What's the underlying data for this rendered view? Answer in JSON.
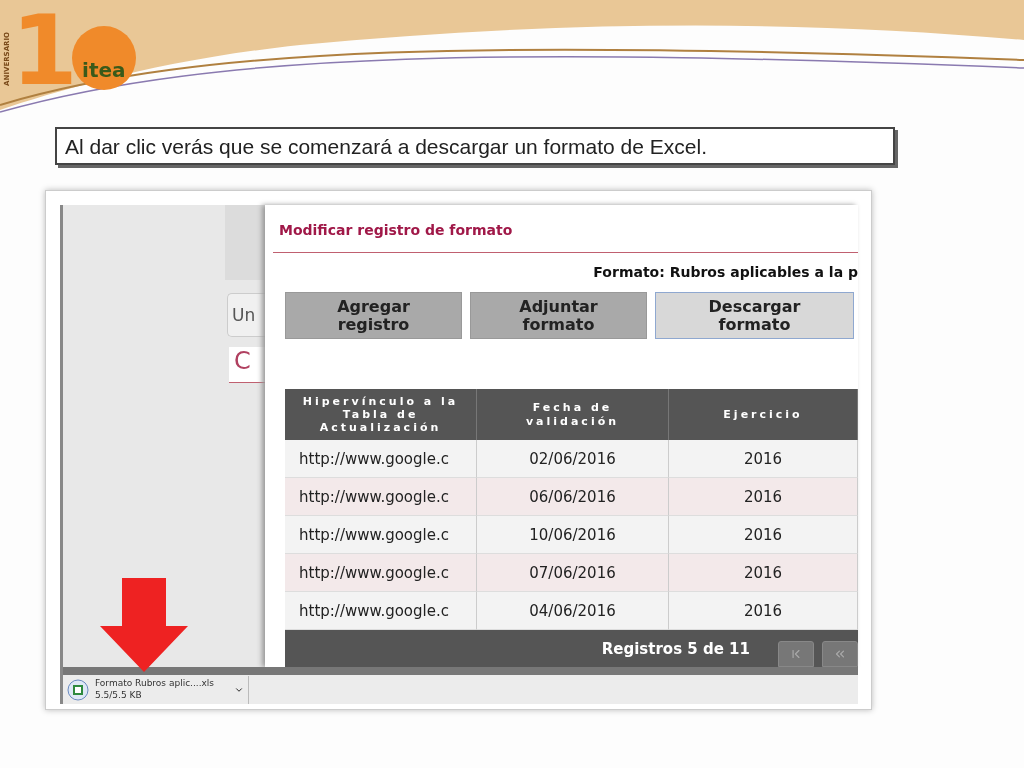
{
  "slide": {
    "logo": {
      "number": "1",
      "ribbon": "ANIVERSARIO",
      "brand": "itea"
    },
    "caption": "Al dar clic verás que se comenzará a descargar un formato de Excel."
  },
  "screenshot": {
    "background_tab": "Un",
    "background_heading": "C",
    "modal": {
      "title": "Modificar registro de formato",
      "format_label": "Formato: Rubros aplicables a la p",
      "buttons": [
        {
          "label": "Agregar\nregistro",
          "selected": false
        },
        {
          "label": "Adjuntar\nformato",
          "selected": false
        },
        {
          "label": "Descargar\nformato",
          "selected": true
        }
      ],
      "table": {
        "columns": [
          "Hipervínculo a la Tabla de Actualización",
          "Fecha de validación",
          "Ejercicio"
        ],
        "rows": [
          [
            "http://www.google.c",
            "02/06/2016",
            "2016"
          ],
          [
            "http://www.google.c",
            "06/06/2016",
            "2016"
          ],
          [
            "http://www.google.c",
            "10/06/2016",
            "2016"
          ],
          [
            "http://www.google.c",
            "07/06/2016",
            "2016"
          ],
          [
            "http://www.google.c",
            "04/06/2016",
            "2016"
          ]
        ],
        "footer": "Registros 5 de 11"
      }
    },
    "download": {
      "filename": "Formato Rubros aplic....xls",
      "progress": "5.5/5.5 KB"
    }
  }
}
